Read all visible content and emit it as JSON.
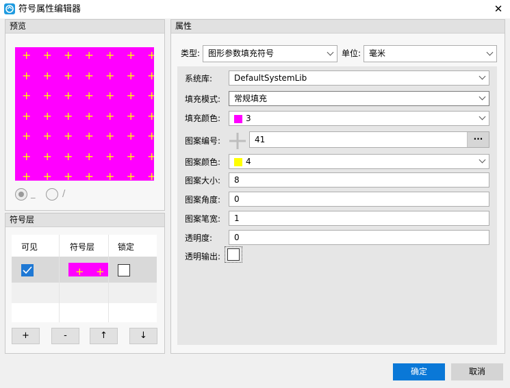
{
  "window": {
    "title": "符号属性编辑器",
    "close_glyph": "✕"
  },
  "preview": {
    "header": "预览",
    "pattern_glyph": "+",
    "fill_color": "#ff00ff",
    "pattern_color": "#ffff00",
    "radio1_label": "_",
    "radio2_label": "/"
  },
  "layers": {
    "header": "符号层",
    "columns": [
      "可见",
      "符号层",
      "锁定"
    ],
    "buttons": {
      "add": "+",
      "remove": "-",
      "up": "↑",
      "down": "↓"
    }
  },
  "properties": {
    "header": "属性",
    "type_label": "类型:",
    "type_value": "图形参数填充符号",
    "unit_label": "单位:",
    "unit_value": "毫米",
    "rows": {
      "system_lib_label": "系统库:",
      "system_lib_value": "DefaultSystemLib",
      "fill_mode_label": "填充模式:",
      "fill_mode_value": "常规填充",
      "fill_color_label": "填充颜色:",
      "fill_color_value": "3",
      "fill_color_swatch": "#ff00ff",
      "pattern_no_label": "图案编号:",
      "pattern_no_value": "41",
      "pattern_no_button": "···",
      "pattern_color_label": "图案颜色:",
      "pattern_color_value": "4",
      "pattern_color_swatch": "#ffff00",
      "pattern_size_label": "图案大小:",
      "pattern_size_value": "8",
      "pattern_angle_label": "图案角度:",
      "pattern_angle_value": "0",
      "pattern_pen_label": "图案笔宽:",
      "pattern_pen_value": "1",
      "transparency_label": "透明度:",
      "transparency_value": "0",
      "transparent_output_label": "透明输出:"
    }
  },
  "dialog": {
    "ok": "确定",
    "cancel": "取消"
  }
}
